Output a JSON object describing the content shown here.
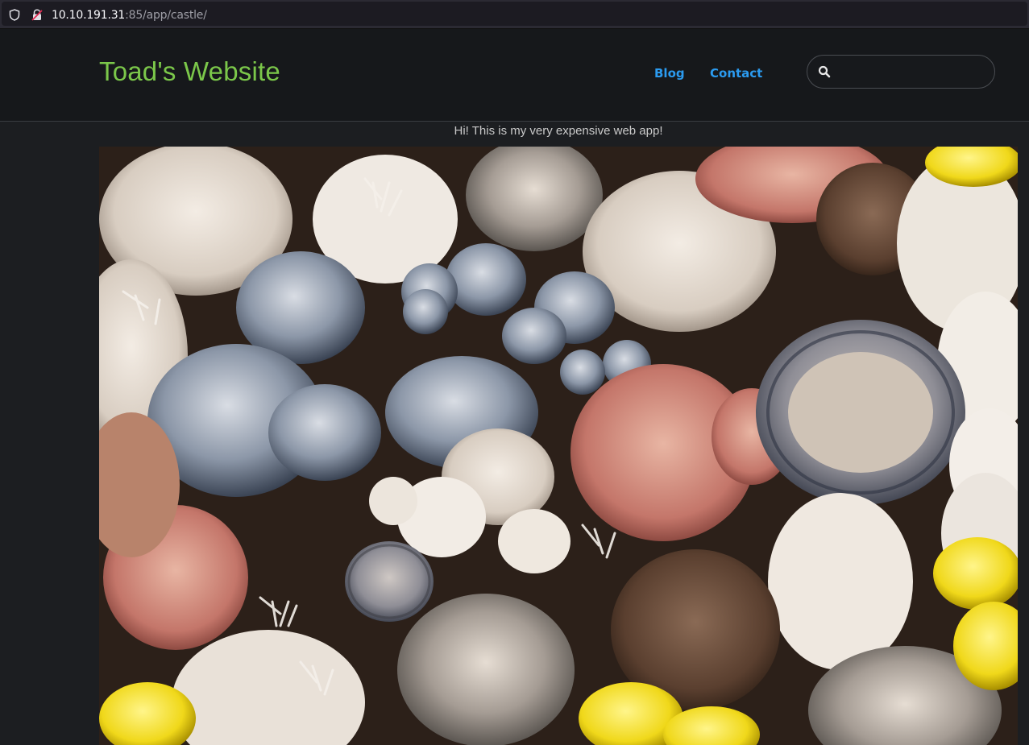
{
  "browser": {
    "url_host": "10.10.191.31",
    "url_rest": ":85/app/castle/",
    "icons": [
      "shield-icon",
      "lock-icon"
    ]
  },
  "header": {
    "brand": "Toad's Website",
    "nav": [
      {
        "label": "Blog"
      },
      {
        "label": "Contact"
      }
    ],
    "search": {
      "placeholder": "",
      "value": "",
      "icon": "search-icon"
    }
  },
  "main": {
    "tagline": "Hi! This is my very expensive web app!",
    "hero_image": {
      "subject": "assorted mushrooms photo"
    }
  },
  "colors": {
    "brand": "#7bc74a",
    "nav_link": "#2b9bf0",
    "page_bg": "#1c1e21",
    "header_bg": "#16181b"
  }
}
